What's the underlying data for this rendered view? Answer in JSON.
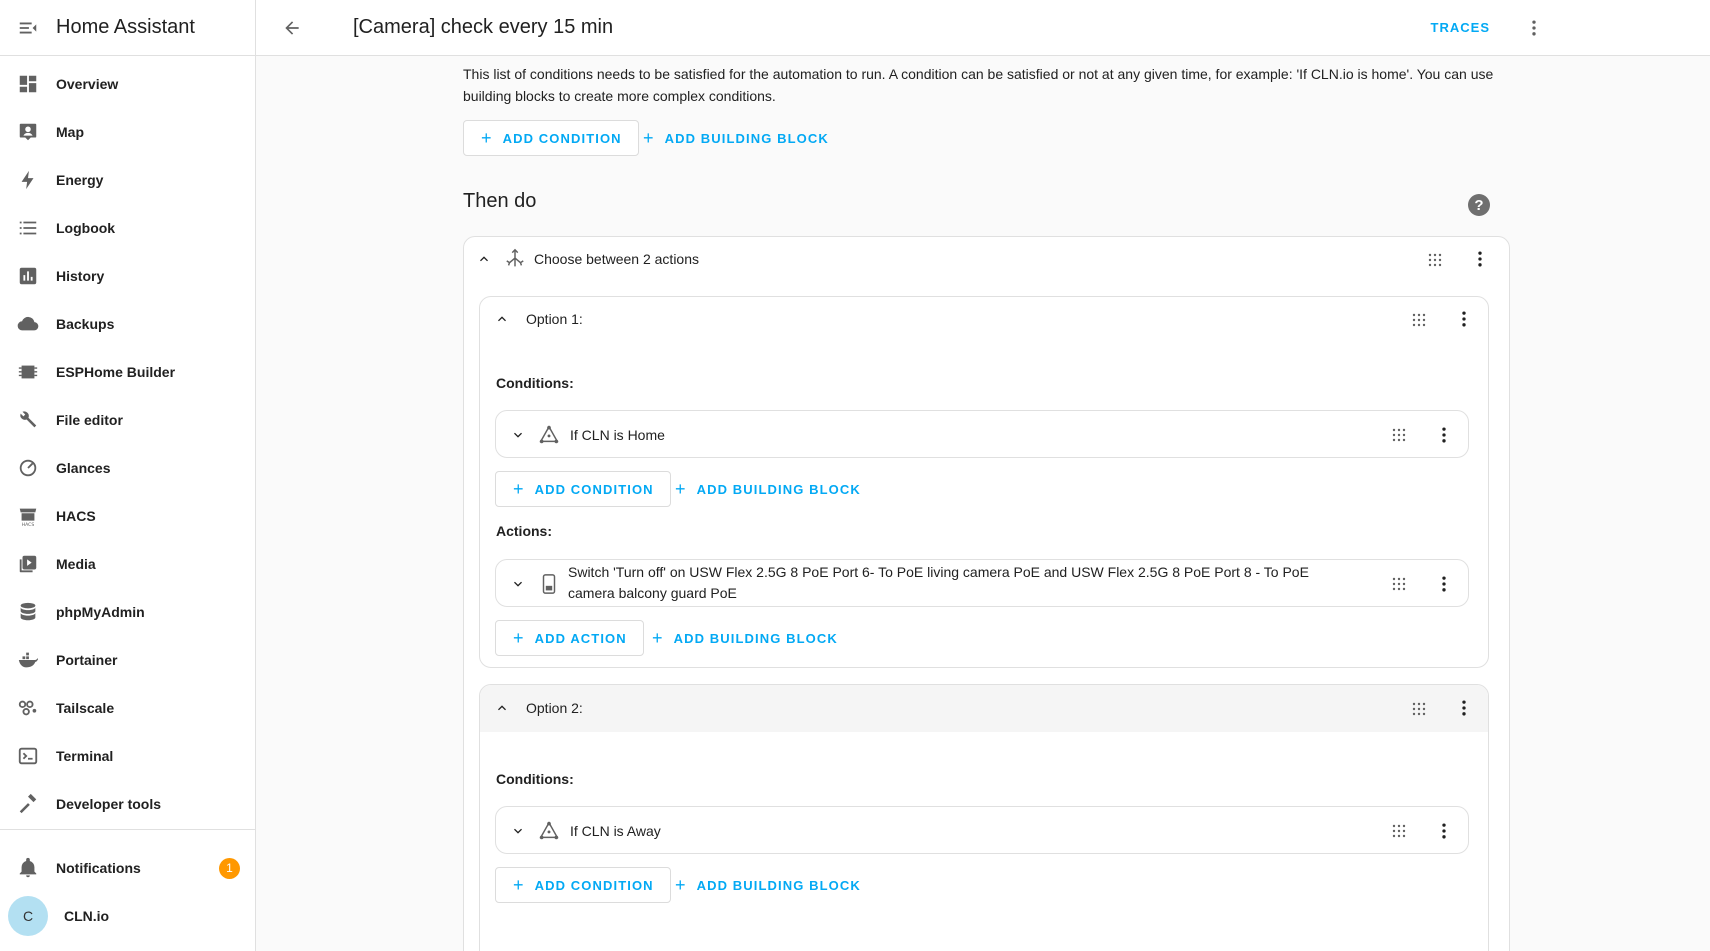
{
  "sidebar": {
    "title": "Home Assistant",
    "items": [
      {
        "label": "Overview",
        "icon": "overview-icon"
      },
      {
        "label": "Map",
        "icon": "map-icon"
      },
      {
        "label": "Energy",
        "icon": "energy-icon"
      },
      {
        "label": "Logbook",
        "icon": "logbook-icon"
      },
      {
        "label": "History",
        "icon": "history-icon"
      },
      {
        "label": "Backups",
        "icon": "cloud-icon"
      },
      {
        "label": "ESPHome Builder",
        "icon": "chip-icon"
      },
      {
        "label": "File editor",
        "icon": "wrench-icon"
      },
      {
        "label": "Glances",
        "icon": "gauge-icon"
      },
      {
        "label": "HACS",
        "icon": "hacs-icon"
      },
      {
        "label": "Media",
        "icon": "media-icon"
      },
      {
        "label": "phpMyAdmin",
        "icon": "database-icon"
      },
      {
        "label": "Portainer",
        "icon": "docker-icon"
      },
      {
        "label": "Tailscale",
        "icon": "tailscale-icon"
      },
      {
        "label": "Terminal",
        "icon": "terminal-icon"
      },
      {
        "label": "Developer tools",
        "icon": "hammer-icon"
      }
    ],
    "notifications": {
      "label": "Notifications",
      "count": "1"
    },
    "user": {
      "label": "CLN.io",
      "initial": "C"
    }
  },
  "topbar": {
    "title": "[Camera] check every 15 min",
    "traces_label": "TRACES"
  },
  "main": {
    "conditions_description": "This list of conditions needs to be satisfied for the automation to run. A condition can be satisfied or not at any given time, for example: 'If CLN.io is home'. You can use building blocks to create more complex conditions.",
    "add_condition_label": "ADD CONDITION",
    "add_building_block_label": "ADD BUILDING BLOCK",
    "add_action_label": "ADD ACTION",
    "then_do_title": "Then do",
    "help_glyph": "?",
    "choose_title": "Choose between 2 actions",
    "conditions_label": "Conditions:",
    "actions_label": "Actions:",
    "option1": {
      "title": "Option 1:",
      "condition": "If CLN is Home",
      "action": "Switch 'Turn off' on USW Flex 2.5G 8 PoE Port 6- To PoE living camera PoE and USW Flex 2.5G 8 PoE Port 8 - To PoE camera balcony guard PoE"
    },
    "option2": {
      "title": "Option 2:",
      "condition": "If CLN is Away"
    }
  },
  "colors": {
    "accent": "#03a9f4",
    "badge": "#ff9800",
    "avatar": "#b3e0f2"
  }
}
